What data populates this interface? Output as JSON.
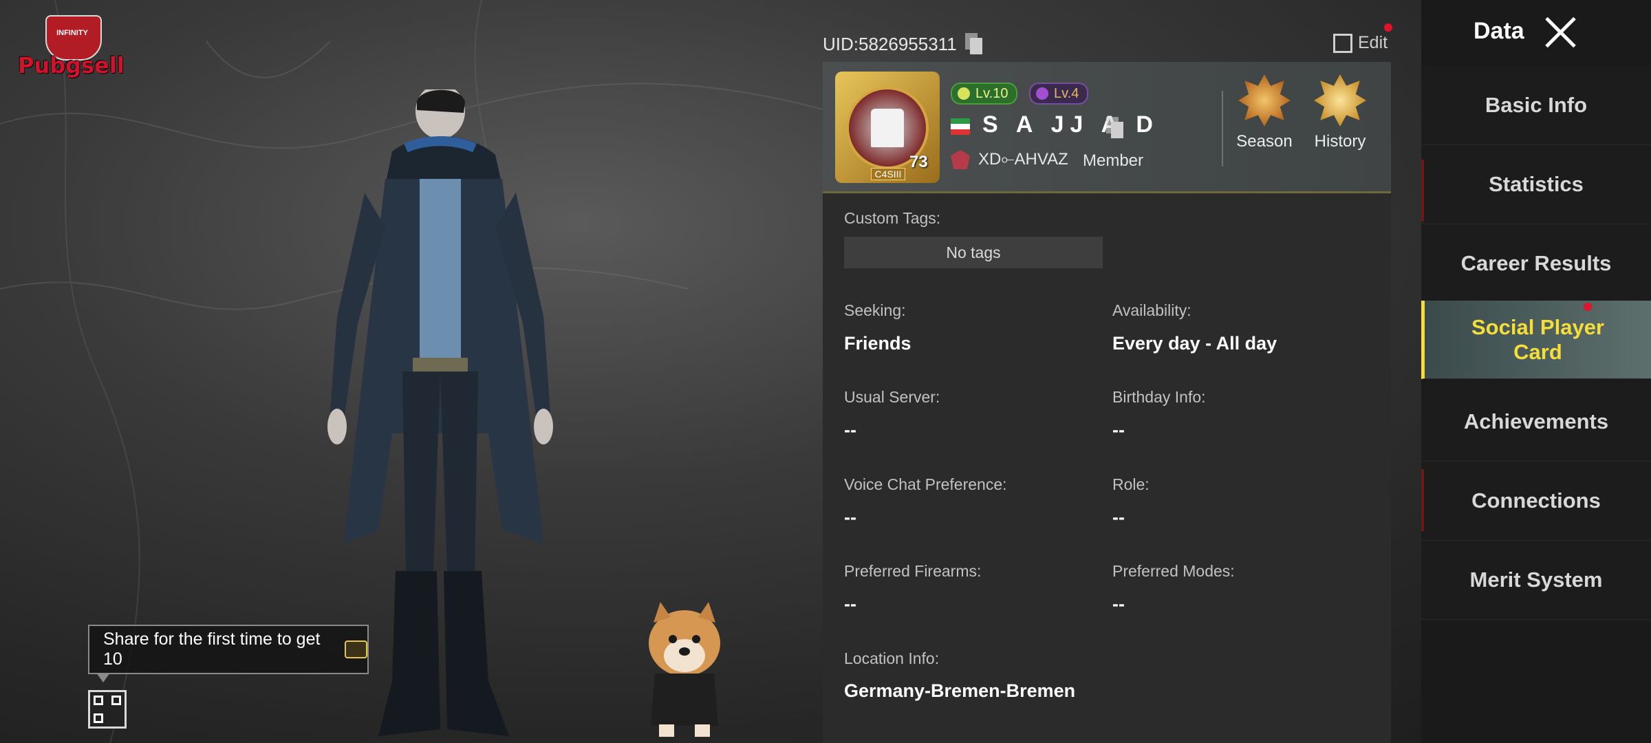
{
  "watermark": {
    "brand": "Pubgsell",
    "sub": "INFINITY"
  },
  "share_tooltip": {
    "text": "Share for the first time to get 10"
  },
  "header": {
    "uid": "UID:5826955311",
    "edit_label": "Edit"
  },
  "profile": {
    "level_badge": "Lv.10",
    "secondary_level": "Lv.4",
    "avatar_level": "73",
    "avatar_tier": "C4SIII",
    "player_name": "S A JJ A D",
    "clan_name": "XD⟜AHVAZ",
    "clan_role": "Member",
    "season_label": "Season",
    "history_label": "History"
  },
  "social_card": {
    "custom_tags_label": "Custom Tags:",
    "custom_tags_value": "No tags",
    "seeking_label": "Seeking:",
    "seeking_value": "Friends",
    "availability_label": "Availability:",
    "availability_value": "Every day - All day",
    "usual_server_label": "Usual Server:",
    "usual_server_value": "--",
    "birthday_label": "Birthday Info:",
    "birthday_value": "--",
    "voice_chat_label": "Voice Chat Preference:",
    "voice_chat_value": "--",
    "role_label": "Role:",
    "role_value": "--",
    "firearms_label": "Preferred Firearms:",
    "firearms_value": "--",
    "modes_label": "Preferred Modes:",
    "modes_value": "--",
    "location_label": "Location Info:",
    "location_value": "Germany-Bremen-Bremen"
  },
  "sidebar": {
    "title": "Data",
    "items": [
      {
        "label": "Basic Info",
        "active": false
      },
      {
        "label": "Statistics",
        "active": false
      },
      {
        "label": "Career Results",
        "active": false
      },
      {
        "label": "Social Player Card",
        "active": true
      },
      {
        "label": "Achievements",
        "active": false
      },
      {
        "label": "Connections",
        "active": false
      },
      {
        "label": "Merit System",
        "active": false
      }
    ]
  },
  "colors": {
    "accent_yellow": "#f6de3a",
    "notification_red": "#e0142a",
    "panel_bg": "#2b2b2b"
  }
}
